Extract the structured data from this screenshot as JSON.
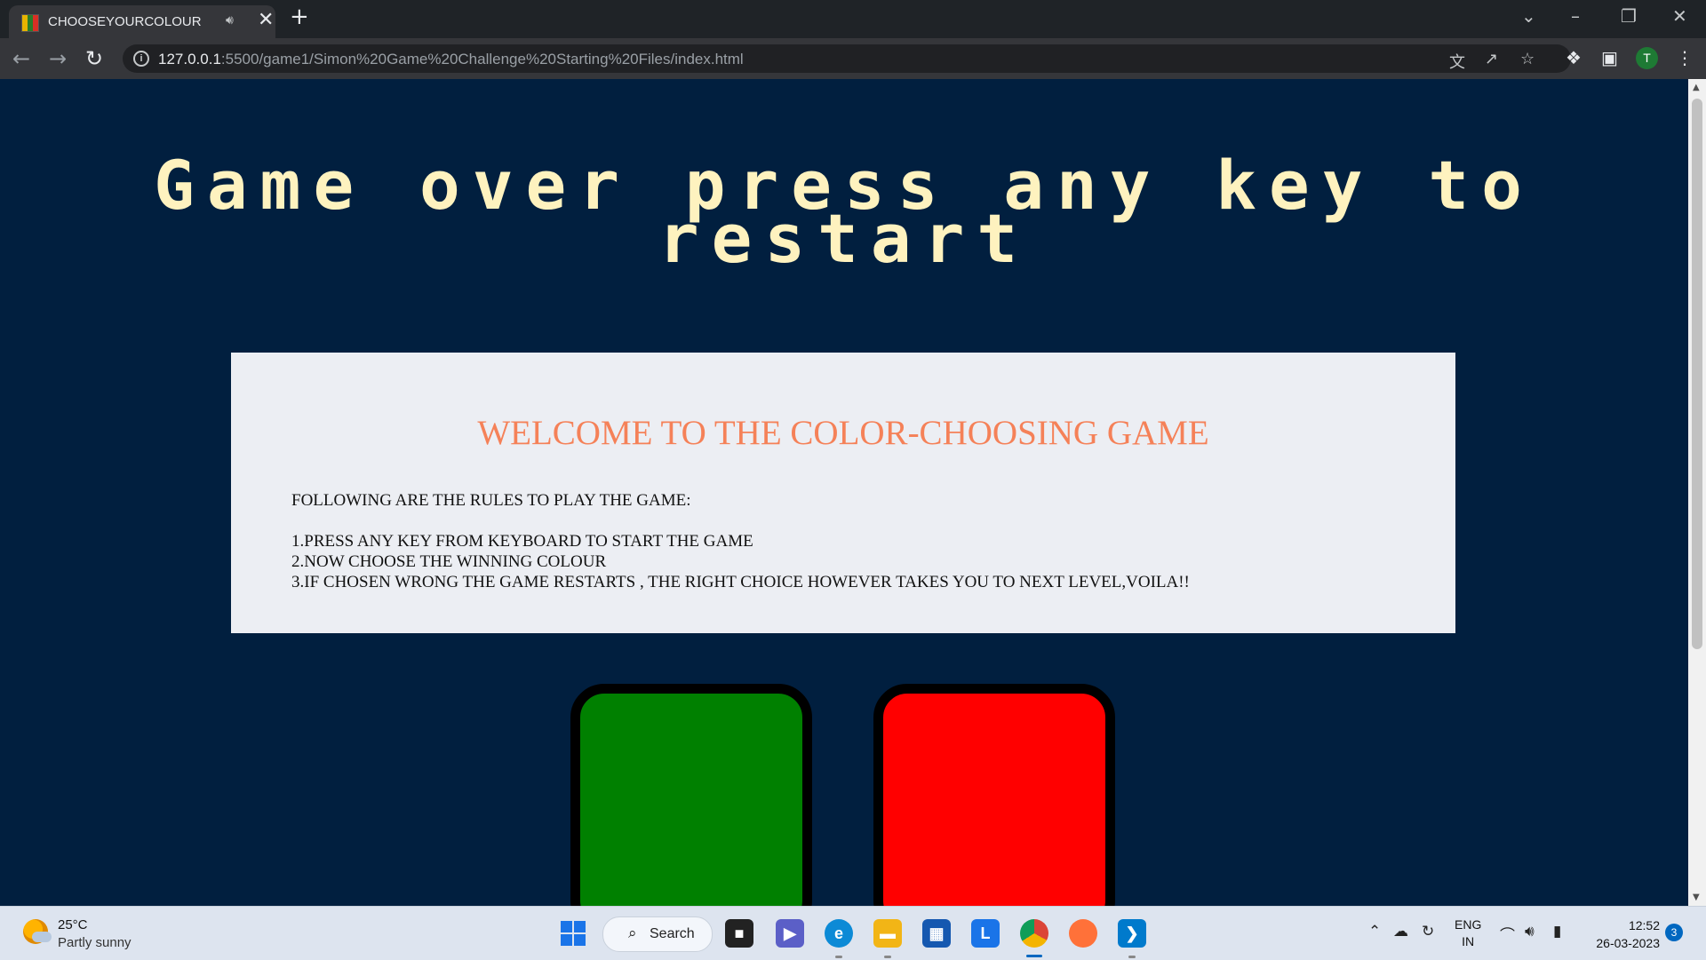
{
  "browser": {
    "tab_title": "CHOOSEYOURCOLOUR",
    "url_host": "127.0.0.1",
    "url_rest": ":5500/game1/Simon%20Game%20Challenge%20Starting%20Files/index.html",
    "profile_initial": "T"
  },
  "game": {
    "level_title": "Game over press any key to restart",
    "rules_heading": "WELCOME TO THE COLOR-CHOOSING GAME",
    "rules_intro": "FOLLOWING ARE THE RULES TO PLAY THE GAME:",
    "rules": [
      "1.PRESS ANY KEY FROM KEYBOARD TO START THE GAME",
      "2.NOW CHOOSE THE WINNING COLOUR",
      "3.IF CHOSEN WRONG THE GAME RESTARTS , THE RIGHT CHOICE HOWEVER TAKES YOU TO NEXT LEVEL,VOILA!!"
    ],
    "buttons": [
      {
        "id": "green",
        "color": "#008000"
      },
      {
        "id": "red",
        "color": "#ff0000"
      }
    ],
    "colors": {
      "background": "#011f3f",
      "title": "#fef2bf",
      "heading": "#f58158",
      "card": "#eceef3"
    }
  },
  "taskbar": {
    "temperature": "25°C",
    "condition": "Partly sunny",
    "search_label": "Search",
    "language_line1": "ENG",
    "language_line2": "IN",
    "time": "12:52",
    "date": "26-03-2023",
    "notification_count": "3"
  }
}
